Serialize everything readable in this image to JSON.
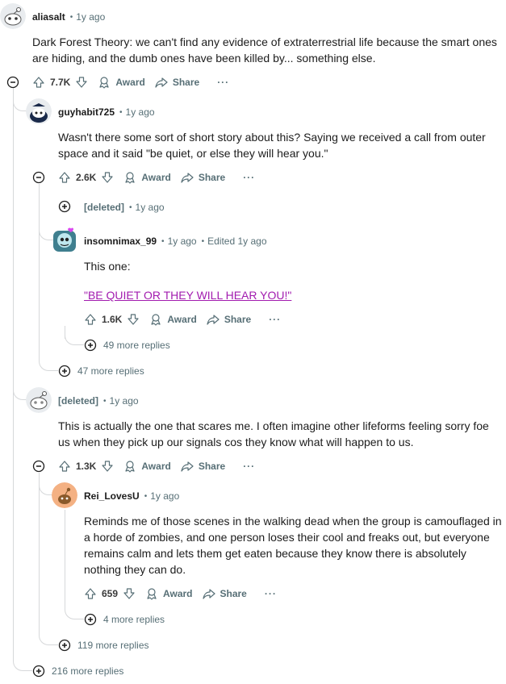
{
  "thread": {
    "c1": {
      "author": "aliasalt",
      "time": "1y ago",
      "body": "Dark Forest Theory: we can't find any evidence of extraterrestrial life because the smart ones are hiding, and the dumb ones have been killed by... something else.",
      "votes": "7.7K"
    },
    "c2": {
      "author": "guyhabit725",
      "time": "1y ago",
      "body": "Wasn't there some sort of short story about this? Saying we received a call from outer space and it said \"be quiet, or else they will hear you.\"",
      "votes": "2.6K"
    },
    "c3": {
      "author": "[deleted]",
      "time": "1y ago"
    },
    "c4": {
      "author": "insomnimax_99",
      "time": "1y ago",
      "edited": "Edited 1y ago",
      "body": "This one:",
      "link": "\"BE QUIET OR THEY WILL HEAR YOU!\"",
      "votes": "1.6K"
    },
    "c5": {
      "author": "[deleted]",
      "time": "1y ago",
      "body": "This is actually the one that scares me. I often imagine other lifeforms feeling sorry foe us when they pick up our signals cos they know what will happen to us.",
      "votes": "1.3K"
    },
    "c6": {
      "author": "Rei_LovesU",
      "time": "1y ago",
      "body": "Reminds me of those scenes in the walking dead when the group is camouflaged in a horde of zombies, and one person loses their cool and freaks out, but everyone remains calm and lets them get eaten because they know there is absolutely nothing they can do.",
      "votes": "659"
    },
    "more": {
      "r49": "49 more replies",
      "r47": "47 more replies",
      "r4": "4 more replies",
      "r119": "119 more replies",
      "r216": "216 more replies"
    }
  },
  "labels": {
    "award": "Award",
    "share": "Share",
    "overflow": "···",
    "separator": "•"
  },
  "colors": {
    "text": "#1c1c1c",
    "meta": "#576f76",
    "thread_line": "#d6d8da",
    "link": "#a21caf"
  }
}
